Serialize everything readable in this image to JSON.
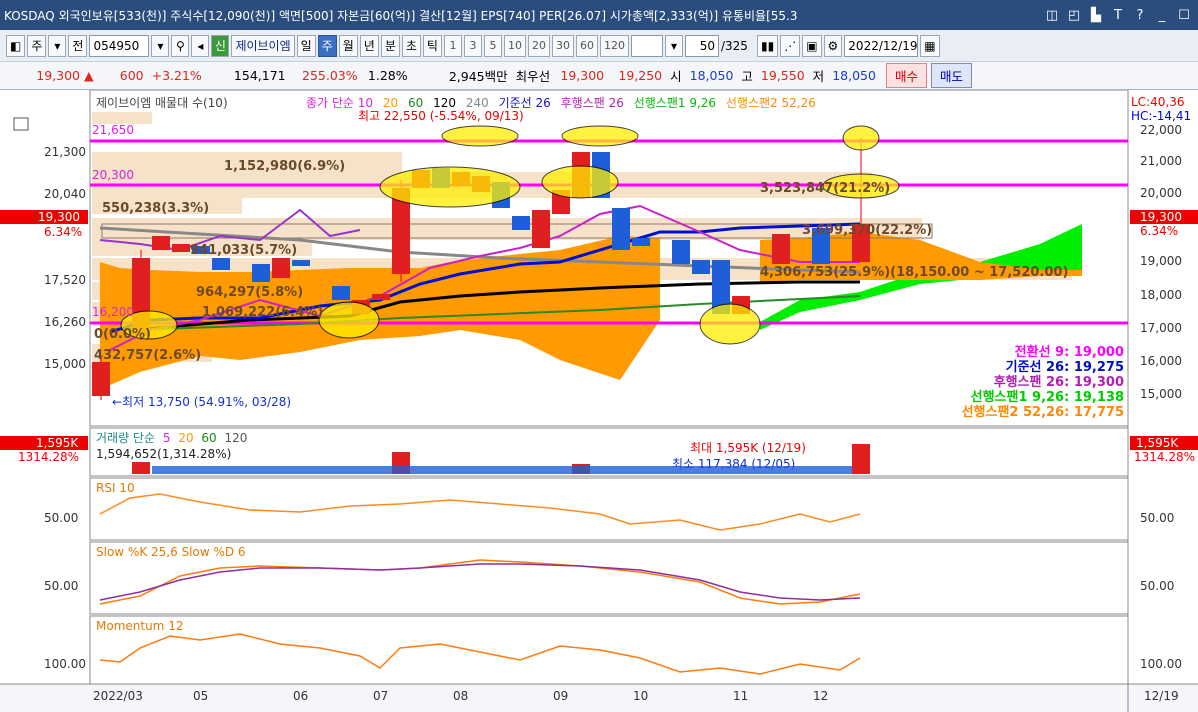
{
  "titlebar": {
    "text": "KOSDAQ 외국인보유[533(천)] 주식수[12,090(천)] 액면[500] 자본금[60(억)] 결산[12월] EPS[740] PER[26.07] 시가총액[2,333(억)] 유통비율[55.3",
    "btns": [
      "◫",
      "◰",
      "▙",
      "T",
      "?",
      "_",
      "☐"
    ]
  },
  "toolbar": {
    "period": "주",
    "prev": "전",
    "code": "054950",
    "stock_name": "제이브이엠",
    "periods": [
      "일",
      "주",
      "월",
      "년",
      "분",
      "초",
      "틱"
    ],
    "intervals": [
      "1",
      "3",
      "5",
      "10",
      "20",
      "30",
      "60",
      "120"
    ],
    "count": "50",
    "total": "/325",
    "date": "2022/12/19"
  },
  "quote": {
    "price": "19,300",
    "arrow": "▲",
    "change": "600",
    "pct": "+3.21%",
    "volume": "154,171",
    "vol_ratio": "255.03%",
    "turnover": "1.28%",
    "amount": "2,945백만",
    "best_label": "최우선",
    "ask": "19,300",
    "bid": "19,250",
    "open_label": "시",
    "open": "18,050",
    "high_label": "고",
    "high": "19,550",
    "low_label": "저",
    "low": "18,050",
    "buy": "매수",
    "sell": "매도"
  },
  "main": {
    "legend1": "제이브이엠 매물대 수(10)",
    "legend2": [
      "종가 단순 10",
      "20",
      "60",
      "120",
      "240",
      "기준선 26",
      "후행스팬 26",
      "선행스팬1 9,26",
      "선행스팬2 52,26"
    ],
    "lc": "LC:40,36",
    "hc": "HC:-14,41",
    "yticks": [
      "22,000",
      "21,000",
      "20,000",
      "19,000",
      "18,000",
      "17,000",
      "16,000",
      "15,000",
      "14,000"
    ],
    "left_ticks": [
      "21,300",
      "20,040",
      "17,520",
      "16,260",
      "15,000"
    ],
    "price_tag": "19,300",
    "pct_tag": "6.34%",
    "hline1": "21,650",
    "hline2": "20,300",
    "hline3": "16,200",
    "max_label": "최고 22,550 (-5.54%, 09/13)",
    "min_label": "←최저 13,750 (54.91%, 03/28)",
    "vp_labels": [
      "1,152,980(6.9%)",
      "3,523,847(21.2%)",
      "550,238(3.3%)",
      "3,699,370(22.2%)",
      "941,033(5.7%)",
      "4,306,753(25.9%)(18,150.00 ~ 17,520.00)",
      "964,297(5.8%)",
      "1,069,222(6.4%)",
      "0(0.0%)",
      "432,757(2.6%)"
    ],
    "ichimoku": [
      "전환선 9: 19,000",
      "기준선 26: 19,275",
      "후행스팬 26: 19,300",
      "선행스팬1 9,26: 19,138",
      "선행스팬2 52,26: 17,775"
    ]
  },
  "volume": {
    "legend": [
      "거래량 단순",
      "5",
      "20",
      "60",
      "120"
    ],
    "current": "1,594,652(1,314.28%)",
    "max_label": "최대 1,595K (12/19)",
    "min_label": "최소 117,384 (12/05)",
    "tag": "1,595K",
    "tag2": "1314.28%"
  },
  "rsi": {
    "legend": "RSI 10",
    "tick": "50.00"
  },
  "stoch": {
    "legend": "Slow %K 25,6  Slow %D 6",
    "tick": "50.00"
  },
  "momentum": {
    "legend": "Momentum 12",
    "tick": "100.00"
  },
  "xaxis": {
    "labels": [
      "2022/03",
      "05",
      "06",
      "07",
      "08",
      "09",
      "10",
      "11",
      "12"
    ],
    "right": "12/19"
  }
}
